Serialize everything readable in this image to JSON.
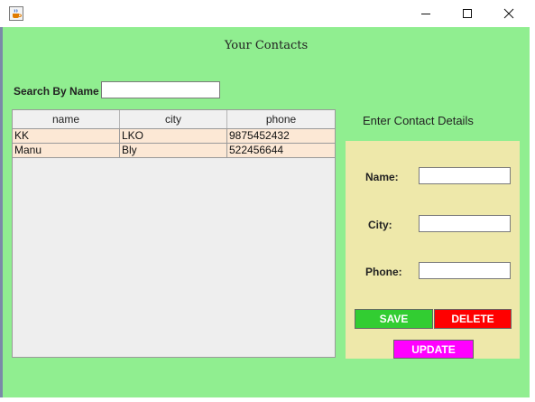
{
  "window": {
    "icon": "java-cup-icon",
    "controls": [
      "minimize-icon",
      "maximize-icon",
      "close-icon"
    ]
  },
  "header": {
    "title": "Your Contacts"
  },
  "search": {
    "label": "Search By Name",
    "value": ""
  },
  "table": {
    "columns": [
      "name",
      "city",
      "phone"
    ],
    "rows": [
      [
        "KK",
        "LKO",
        "9875452432"
      ],
      [
        "Manu",
        "Bly",
        "522456644"
      ]
    ],
    "row_color": "#fce8d5"
  },
  "details": {
    "title": "Enter Contact Details",
    "name_label": "Name:",
    "name_value": "",
    "city_label": "City:",
    "city_value": "",
    "phone_label": "Phone:",
    "phone_value": ""
  },
  "actions": {
    "save_label": "SAVE",
    "delete_label": "DELETE",
    "update_label": "UPDATE"
  },
  "colors": {
    "background": "#90ee90",
    "panel": "#eee8aa",
    "save": "#32cd32",
    "delete": "#ff0000",
    "update": "#ff00ff"
  }
}
